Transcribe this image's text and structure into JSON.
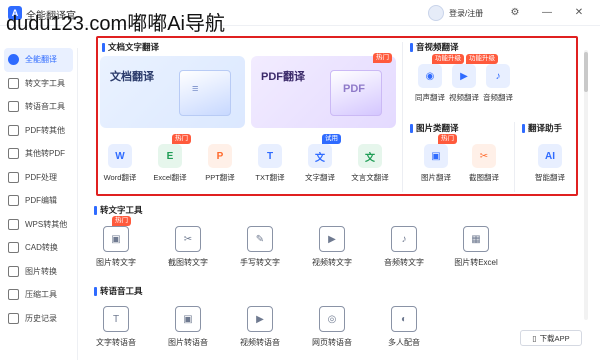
{
  "watermark": "dudu123.com嘟嘟Ai导航",
  "titlebar": {
    "app_name": "全能翻译官",
    "login": "登录/注册"
  },
  "sidebar": {
    "items": [
      {
        "label": "全能翻译",
        "active": true,
        "icon": "home-icon"
      },
      {
        "label": "转文字工具",
        "icon": "text-tool-icon"
      },
      {
        "label": "转语音工具",
        "icon": "voice-tool-icon"
      },
      {
        "label": "PDF转其他",
        "icon": "pdf-convert-icon"
      },
      {
        "label": "其他转PDF",
        "icon": "to-pdf-icon"
      },
      {
        "label": "PDF处理",
        "icon": "pdf-process-icon"
      },
      {
        "label": "PDF编辑",
        "icon": "pdf-edit-icon"
      },
      {
        "label": "WPS转其他",
        "icon": "wps-icon"
      },
      {
        "label": "CAD转换",
        "icon": "cad-icon"
      },
      {
        "label": "图片转换",
        "icon": "image-icon"
      },
      {
        "label": "压缩工具",
        "icon": "compress-icon"
      },
      {
        "label": "历史记录",
        "icon": "history-icon"
      }
    ]
  },
  "doc_section": {
    "title": "文档文字翻译",
    "cards": [
      {
        "label": "文档翻译"
      },
      {
        "label": "PDF翻译",
        "badge": "热门"
      }
    ],
    "tools": [
      {
        "label": "Word翻译",
        "glyph": "W",
        "color": "#2f6bff",
        "bg": "#e8efff"
      },
      {
        "label": "Excel翻译",
        "glyph": "E",
        "color": "#1f9d55",
        "bg": "#e6f6ec",
        "badge": "热门"
      },
      {
        "label": "PPT翻译",
        "glyph": "P",
        "color": "#ff6a2c",
        "bg": "#fff0e8"
      },
      {
        "label": "TXT翻译",
        "glyph": "T",
        "color": "#2f6bff",
        "bg": "#e8efff"
      },
      {
        "label": "文字翻译",
        "glyph": "文",
        "color": "#2f6bff",
        "bg": "#e8efff",
        "badge_try": "试用"
      },
      {
        "label": "文言文翻译",
        "glyph": "文",
        "color": "#1f9d55",
        "bg": "#e6f6ec"
      }
    ]
  },
  "av_section": {
    "title": "音视频翻译",
    "tools": [
      {
        "label": "同声翻译",
        "glyph": "◉",
        "color": "#2f6bff",
        "bg": "#e8efff",
        "badge": "功能升级"
      },
      {
        "label": "视频翻译",
        "glyph": "▶",
        "color": "#2f6bff",
        "bg": "#e8efff",
        "badge": "功能升级"
      },
      {
        "label": "音频翻译",
        "glyph": "♪",
        "color": "#2f6bff",
        "bg": "#e8efff"
      }
    ]
  },
  "img_section": {
    "title": "图片类翻译",
    "tools": [
      {
        "label": "图片翻译",
        "glyph": "▣",
        "color": "#2f6bff",
        "bg": "#e8efff",
        "badge": "热门"
      },
      {
        "label": "截图翻译",
        "glyph": "✂",
        "color": "#ff6a2c",
        "bg": "#fff0e8"
      }
    ]
  },
  "assist_section": {
    "title": "翻译助手",
    "tools": [
      {
        "label": "智能翻译",
        "glyph": "AI",
        "color": "#2f6bff",
        "bg": "#e8efff"
      }
    ]
  },
  "text_tools": {
    "title": "转文字工具",
    "items": [
      {
        "label": "图片转文字",
        "badge": "热门"
      },
      {
        "label": "截图转文字"
      },
      {
        "label": "手写转文字"
      },
      {
        "label": "视频转文字"
      },
      {
        "label": "音频转文字"
      },
      {
        "label": "图片转Excel"
      }
    ]
  },
  "voice_tools": {
    "title": "转语音工具",
    "items": [
      {
        "label": "文字转语音"
      },
      {
        "label": "图片转语音"
      },
      {
        "label": "视频转语音"
      },
      {
        "label": "网页转语音"
      },
      {
        "label": "多人配音"
      }
    ]
  },
  "download_btn": "下载APP"
}
